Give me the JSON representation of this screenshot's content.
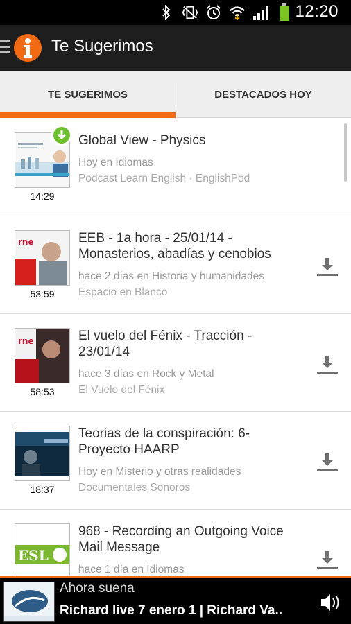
{
  "status_bar": {
    "time": "12:20",
    "icons": [
      "bluetooth-icon",
      "vibrate-icon",
      "alarm-icon",
      "wifi-icon",
      "signal-icon",
      "battery-icon"
    ]
  },
  "app": {
    "title": "Te Sugerimos",
    "accent": "#f26a12"
  },
  "tabs": [
    {
      "label": "TE SUGERIMOS",
      "active": true
    },
    {
      "label": "DESTACADOS HOY",
      "active": false
    }
  ],
  "items": [
    {
      "title": "Global View - Physics",
      "meta": "Hoy en Idiomas",
      "source": "Podcast Learn English · EnglishPod",
      "duration": "14:29",
      "downloaded": true
    },
    {
      "title": "EEB - 1a hora - 25/01/14 - Monasterios, abadías y cenobios",
      "meta": "hace 2 días en Historia y humanidades",
      "source": "Espacio en Blanco",
      "duration": "53:59",
      "downloaded": false
    },
    {
      "title": "El vuelo del Fénix - Tracción - 23/01/14",
      "meta": "hace 3 días en Rock y Metal",
      "source": "El Vuelo del Fénix",
      "duration": "58:53",
      "downloaded": false
    },
    {
      "title": "Teorias de la conspiración: 6-Proyecto HAARP",
      "meta": "Hoy en Misterio y otras realidades",
      "source": "Documentales Sonoros",
      "duration": "18:37",
      "downloaded": false
    },
    {
      "title": "968 - Recording an Outgoing Voice Mail Message",
      "meta": "hace 1 día en Idiomas",
      "source": "",
      "duration": "",
      "downloaded": false
    }
  ],
  "player": {
    "label": "Ahora suena",
    "track": "Richard live 7 enero 1 | Richard Va.."
  }
}
